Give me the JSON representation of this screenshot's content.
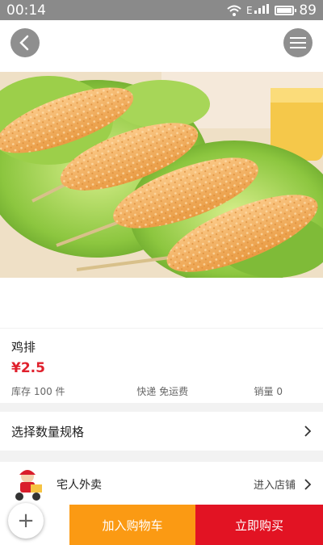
{
  "status_bar": {
    "time": "00:14",
    "signal_text": "E",
    "battery_level": "89",
    "battery_fraction": 0.89
  },
  "header": {
    "back_icon": "chevron-left-icon",
    "menu_icon": "hamburger-menu-icon"
  },
  "product": {
    "image_subject": "fried chicken cutlet skewers on lettuce",
    "name": "鸡排",
    "price": "¥2.5",
    "stock": "库存 100 件",
    "shipping": "快递 免运费",
    "sales": "销量 0"
  },
  "spec": {
    "label": "选择数量规格"
  },
  "shop": {
    "name": "宅人外卖",
    "enter_label": "进入店铺"
  },
  "bottom_bar": {
    "add_to_cart": "加入购物车",
    "buy_now": "立即购买",
    "fab_label": "+"
  },
  "colors": {
    "price": "#e0202c",
    "cart_button": "#fb9a13",
    "buy_button": "#e21323",
    "status_bar": "#8a8a8a"
  }
}
